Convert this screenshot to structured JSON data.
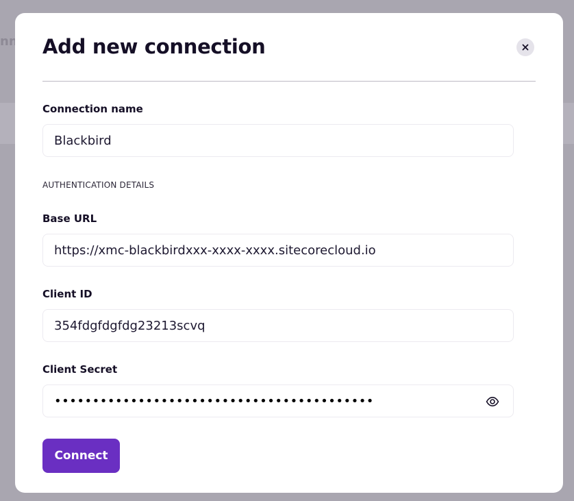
{
  "background": {
    "partial_title": "nn"
  },
  "modal": {
    "title": "Add new connection",
    "close_icon": "close-icon"
  },
  "form": {
    "connection_name": {
      "label": "Connection name",
      "value": "Blackbird"
    },
    "section_heading": "AUTHENTICATION DETAILS",
    "base_url": {
      "label": "Base URL",
      "value": "https://xmc-blackbirdxxx-xxxx-xxxx.sitecorecloud.io"
    },
    "client_id": {
      "label": "Client ID",
      "value": "354fdgfdgfdg23213scvq"
    },
    "client_secret": {
      "label": "Client Secret",
      "masked_value": "••••••••••••••••••••••••••••••••••••••••••",
      "reveal_icon": "eye-icon"
    },
    "submit_label": "Connect"
  },
  "colors": {
    "accent": "#6a2fc2",
    "overlay": "#a9a6b0",
    "text": "#150f26"
  }
}
